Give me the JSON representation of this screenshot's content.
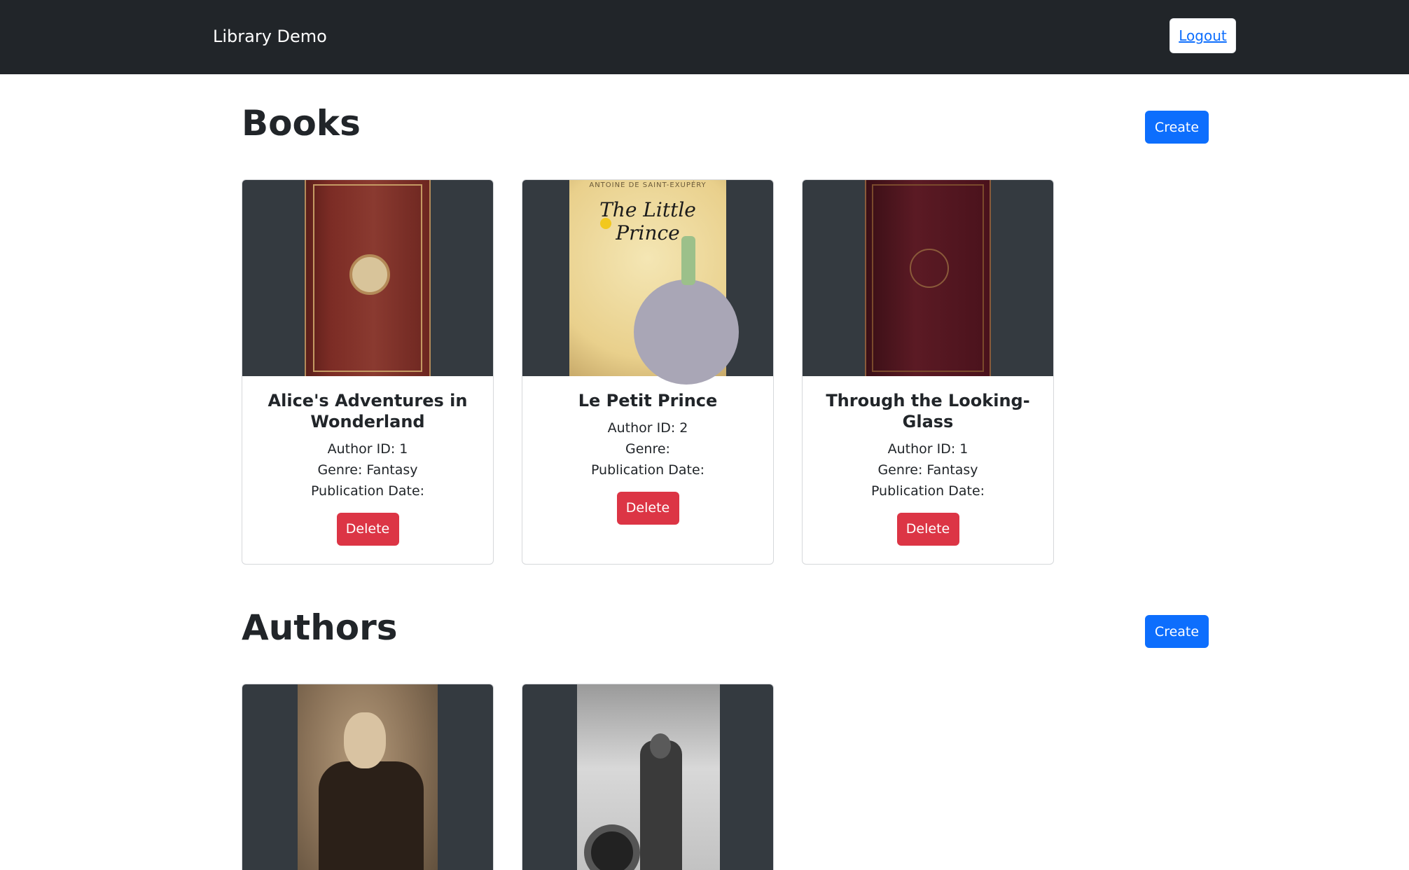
{
  "navbar": {
    "brand": "Library Demo",
    "logout_label": "Logout"
  },
  "books_section": {
    "title": "Books",
    "create_label": "Create",
    "cards": [
      {
        "title": "Alice's Adventures in Wonderland",
        "author_line": "Author ID: 1",
        "genre_line": "Genre: Fantasy",
        "date_line": "Publication Date:",
        "delete_label": "Delete"
      },
      {
        "title": "Le Petit Prince",
        "author_line": "Author ID: 2",
        "genre_line": "Genre:",
        "date_line": "Publication Date:",
        "delete_label": "Delete",
        "cover_title": "The Little Prince",
        "cover_author": "ANTOINE DE SAINT-EXUPÉRY"
      },
      {
        "title": "Through the Looking-Glass",
        "author_line": "Author ID: 1",
        "genre_line": "Genre: Fantasy",
        "date_line": "Publication Date:",
        "delete_label": "Delete"
      }
    ]
  },
  "authors_section": {
    "title": "Authors",
    "create_label": "Create",
    "cards": [
      {
        "photo": "portrait-sepia"
      },
      {
        "photo": "portrait-bw-aviator"
      }
    ]
  },
  "colors": {
    "navbar": "#212529",
    "primary": "#0d6efd",
    "danger": "#dc3545",
    "image_bg": "#343a40"
  }
}
